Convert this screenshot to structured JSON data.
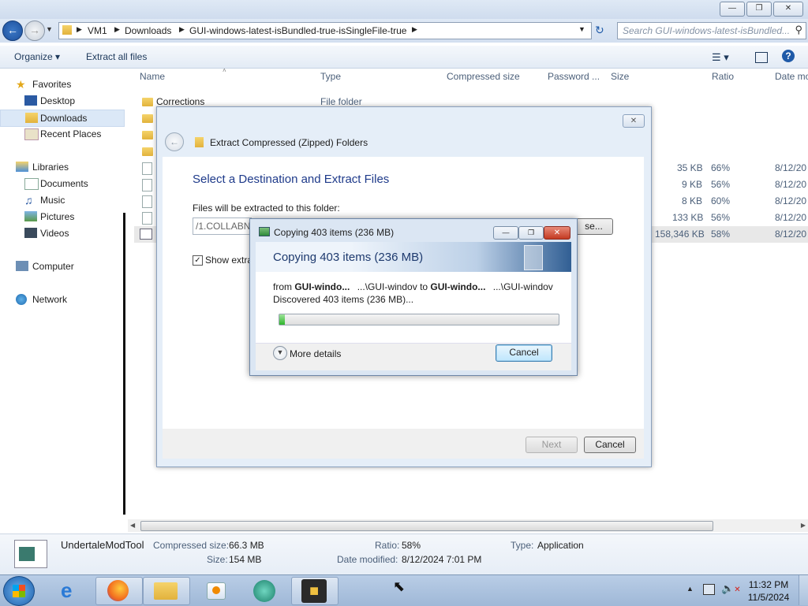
{
  "explorer": {
    "address": {
      "crumbs": [
        "VM1",
        "Downloads",
        "GUI-windows-latest-isBundled-true-isSingleFile-true"
      ]
    },
    "search_placeholder": "Search GUI-windows-latest-isBundled...",
    "toolbar": {
      "organize": "Organize",
      "extract_all": "Extract all files"
    },
    "nav": {
      "favorites": "Favorites",
      "desktop": "Desktop",
      "downloads": "Downloads",
      "recent": "Recent Places",
      "libraries": "Libraries",
      "documents": "Documents",
      "music": "Music",
      "pictures": "Pictures",
      "videos": "Videos",
      "computer": "Computer",
      "network": "Network"
    },
    "columns": [
      "Name",
      "Type",
      "Compressed size",
      "Password ...",
      "Size",
      "Ratio",
      "Date mo"
    ],
    "rows": [
      {
        "name": "Corrections",
        "type": "File folder",
        "size": "",
        "ratio": "",
        "date": ""
      },
      {
        "name": "",
        "type": "",
        "size": "35 KB",
        "ratio": "66%",
        "date": "8/12/20"
      },
      {
        "name": "",
        "type": "",
        "size": "9 KB",
        "ratio": "56%",
        "date": "8/12/20"
      },
      {
        "name": "",
        "type": "",
        "size": "8 KB",
        "ratio": "60%",
        "date": "8/12/20"
      },
      {
        "name": "",
        "type": "",
        "size": "133 KB",
        "ratio": "56%",
        "date": "8/12/20"
      },
      {
        "name": "",
        "type": "",
        "size": "158,346 KB",
        "ratio": "58%",
        "date": "8/12/20"
      }
    ]
  },
  "wizard": {
    "title": "Extract Compressed (Zipped) Folders",
    "heading": "Select a Destination and Extract Files",
    "dest_label": "Files will be extracted to this folder:",
    "dest_value": "/1.COLLABN",
    "browse": "se...",
    "show_extracted": "Show extra",
    "next": "Next",
    "cancel": "Cancel"
  },
  "copy_dialog": {
    "title": "Copying 403 items (236 MB)",
    "header": "Copying 403 items (236 MB)",
    "from_prefix": "from",
    "from_name": "GUI-windo...",
    "from_path": "...\\GUI-windov",
    "to_prefix": "to",
    "to_name": "GUI-windo...",
    "to_path": "...\\GUI-windov",
    "discovered": "Discovered 403 items (236 MB)...",
    "progress_fraction": 0.02,
    "more_details": "More details",
    "cancel": "Cancel"
  },
  "details_pane": {
    "name": "UndertaleModTool",
    "compressed_label": "Compressed size:",
    "compressed_value": "66.3 MB",
    "size_label": "Size:",
    "size_value": "154 MB",
    "ratio_label": "Ratio:",
    "ratio_value": "58%",
    "modified_label": "Date modified:",
    "modified_value": "8/12/2024 7:01 PM",
    "type_label": "Type:",
    "type_value": "Application"
  },
  "taskbar": {
    "time": "11:32 PM",
    "date": "11/5/2024"
  }
}
